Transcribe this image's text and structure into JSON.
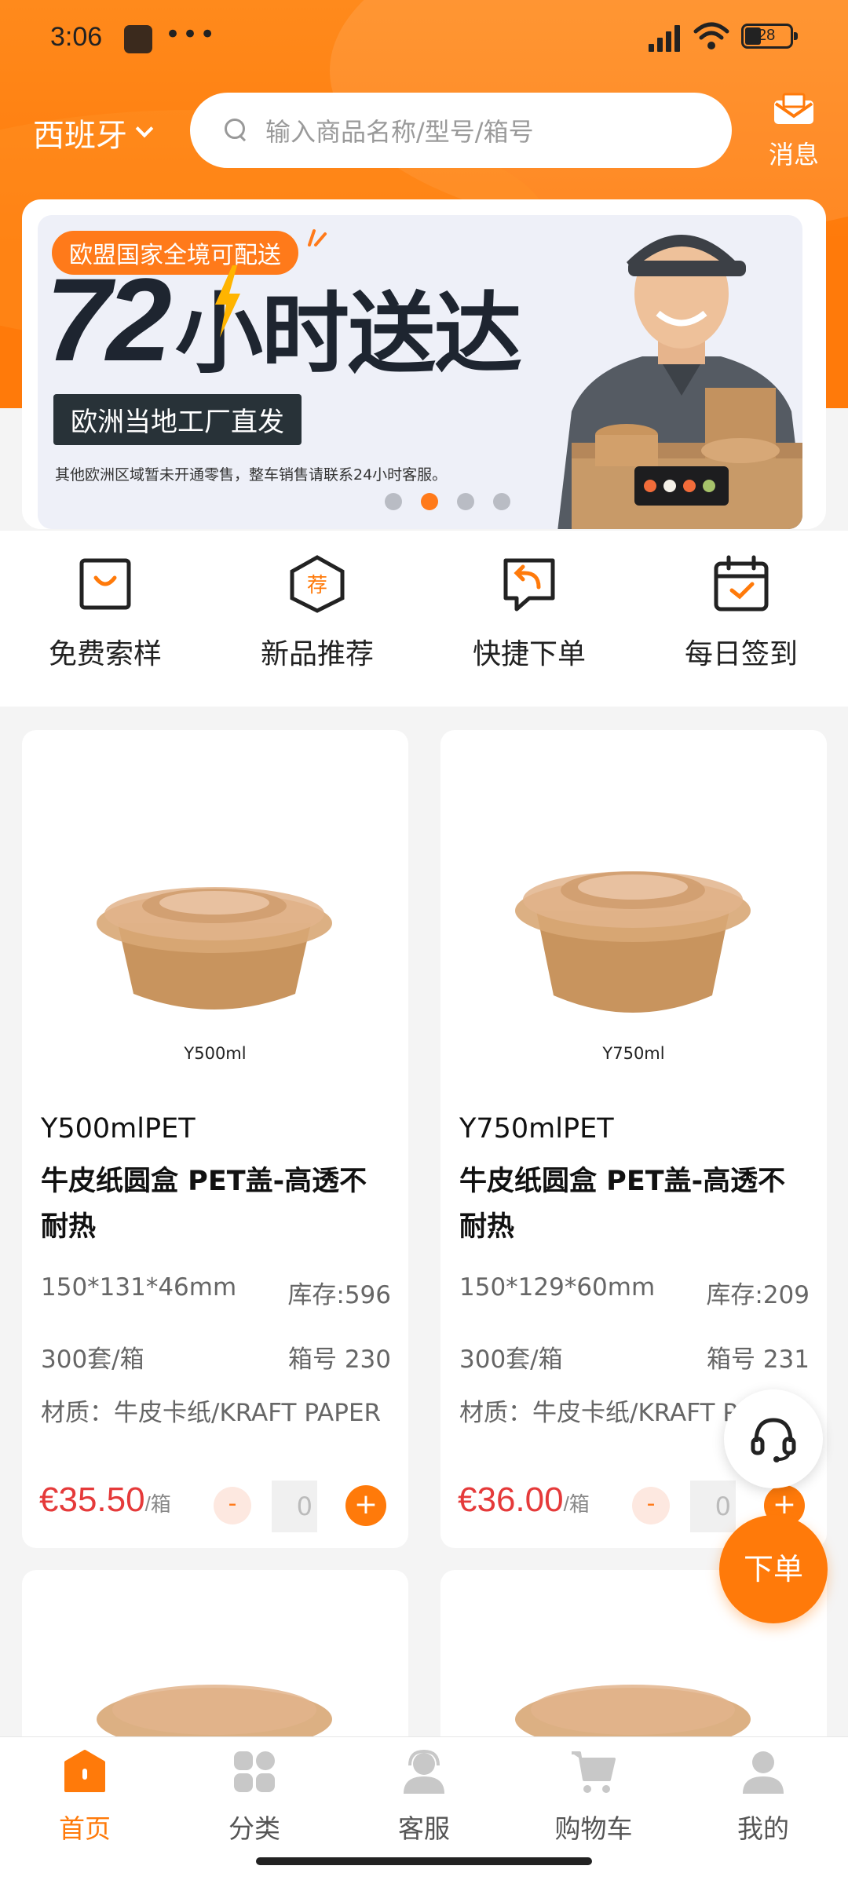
{
  "status_bar": {
    "time": "3:06",
    "battery": "28"
  },
  "header": {
    "region": "西班牙",
    "search_placeholder": "输入商品名称/型号/箱号",
    "message_label": "消息"
  },
  "banner": {
    "tag": "欧盟国家全境可配送",
    "headline_number": "72",
    "headline_text": "小时送达",
    "subtitle": "欧洲当地工厂直发",
    "note": "其他欧洲区域暂未开通零售，整车销售请联系24小时客服。",
    "active_slide": 2,
    "slide_count": 4
  },
  "quick_actions": [
    {
      "label": "免费索样",
      "icon": "gift-bag-icon"
    },
    {
      "label": "新品推荐",
      "icon": "recommend-badge-icon"
    },
    {
      "label": "快捷下单",
      "icon": "quick-order-icon"
    },
    {
      "label": "每日签到",
      "icon": "calendar-check-icon"
    }
  ],
  "products": [
    {
      "image_label": "Y500ml",
      "model": "Y500mlPET",
      "name": "牛皮纸圆盒 PET盖-高透不耐热",
      "dimensions": "150*131*46mm",
      "stock": "库存:596",
      "pack": "300套/箱",
      "box_no": "箱号 230",
      "material": "材质：牛皮卡纸/KRAFT PAPER",
      "price": "€35.50",
      "unit": "/箱",
      "qty": "0"
    },
    {
      "image_label": "Y750ml",
      "model": "Y750mlPET",
      "name": "牛皮纸圆盒 PET盖-高透不耐热",
      "dimensions": "150*129*60mm",
      "stock": "库存:209",
      "pack": "300套/箱",
      "box_no": "箱号 231",
      "material": "材质：牛皮卡纸/KRAFT PAPER",
      "price": "€36.00",
      "unit": "/箱",
      "qty": "0"
    }
  ],
  "qty_controls": {
    "minus": "-",
    "plus": "+"
  },
  "fab": {
    "order_label": "下单",
    "support_icon": "headset-icon"
  },
  "tabs": [
    {
      "label": "首页",
      "icon": "home-icon",
      "active": true
    },
    {
      "label": "分类",
      "icon": "category-grid-icon",
      "active": false
    },
    {
      "label": "客服",
      "icon": "customer-service-icon",
      "active": false
    },
    {
      "label": "购物车",
      "icon": "cart-icon",
      "active": false
    },
    {
      "label": "我的",
      "icon": "profile-icon",
      "active": false
    }
  ],
  "colors": {
    "accent": "#ff7a0a",
    "price": "#e53a3a",
    "dark": "#1e2530"
  }
}
